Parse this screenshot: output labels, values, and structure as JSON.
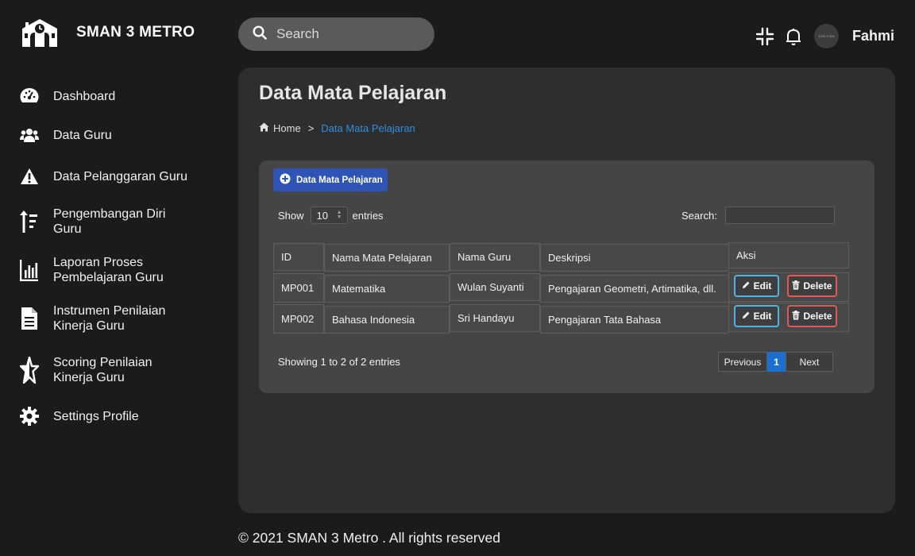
{
  "brand": {
    "name": "SMAN 3 METRO"
  },
  "sidebar": {
    "items": [
      {
        "label": "Dashboard",
        "icon": "gauge-icon"
      },
      {
        "label": "Data Guru",
        "icon": "users-icon"
      },
      {
        "label": "Data Pelanggaran Guru",
        "icon": "warning-icon"
      },
      {
        "label": "Pengembangan Diri\nGuru",
        "icon": "sort-up-icon"
      },
      {
        "label": "Laporan Proses\nPembelajaran Guru",
        "icon": "chart-icon"
      },
      {
        "label": "Instrumen Penilaian\nKinerja Guru",
        "icon": "document-icon"
      },
      {
        "label": "Scoring Penilaian\nKinerja Guru",
        "icon": "star-icon"
      },
      {
        "label": "Settings Profile",
        "icon": "gear-icon"
      }
    ]
  },
  "topbar": {
    "search_placeholder": "Search",
    "avatar_text": "1200 X 900",
    "username": "Fahmi"
  },
  "page": {
    "title": "Data Mata Pelajaran",
    "breadcrumb": {
      "home": "Home",
      "separator": ">",
      "current": "Data Mata Pelajaran"
    }
  },
  "table_card": {
    "add_button": "Data Mata Pelajaran",
    "show_label": "Show",
    "show_value": "10",
    "entries_label": "entries",
    "search_label": "Search:",
    "columns": [
      "ID",
      "Nama Mata Pelajaran",
      "Nama Guru",
      "Deskripsi",
      "Aksi"
    ],
    "rows": [
      {
        "id": "MP001",
        "mapel": "Matematika",
        "guru": "Wulan Suyanti",
        "deskripsi": "Pengajaran Geometri, Artimatika, dll."
      },
      {
        "id": "MP002",
        "mapel": "Bahasa Indonesia",
        "guru": "Sri Handayu",
        "deskripsi": "Pengajaran Tata Bahasa"
      }
    ],
    "edit_label": "Edit",
    "delete_label": "Delete",
    "showing_text": "Showing 1 to 2 of 2 entries",
    "pager": {
      "previous": "Previous",
      "current_page": "1",
      "next": "Next"
    }
  },
  "footer": {
    "text": "© 2021 SMAN 3 Metro . All rights reserved"
  },
  "colors": {
    "accent": "#2e55b6",
    "link": "#2e8fe0",
    "edit": "#4db3e0",
    "delete": "#e05858",
    "page_active": "#1a6fd0"
  }
}
